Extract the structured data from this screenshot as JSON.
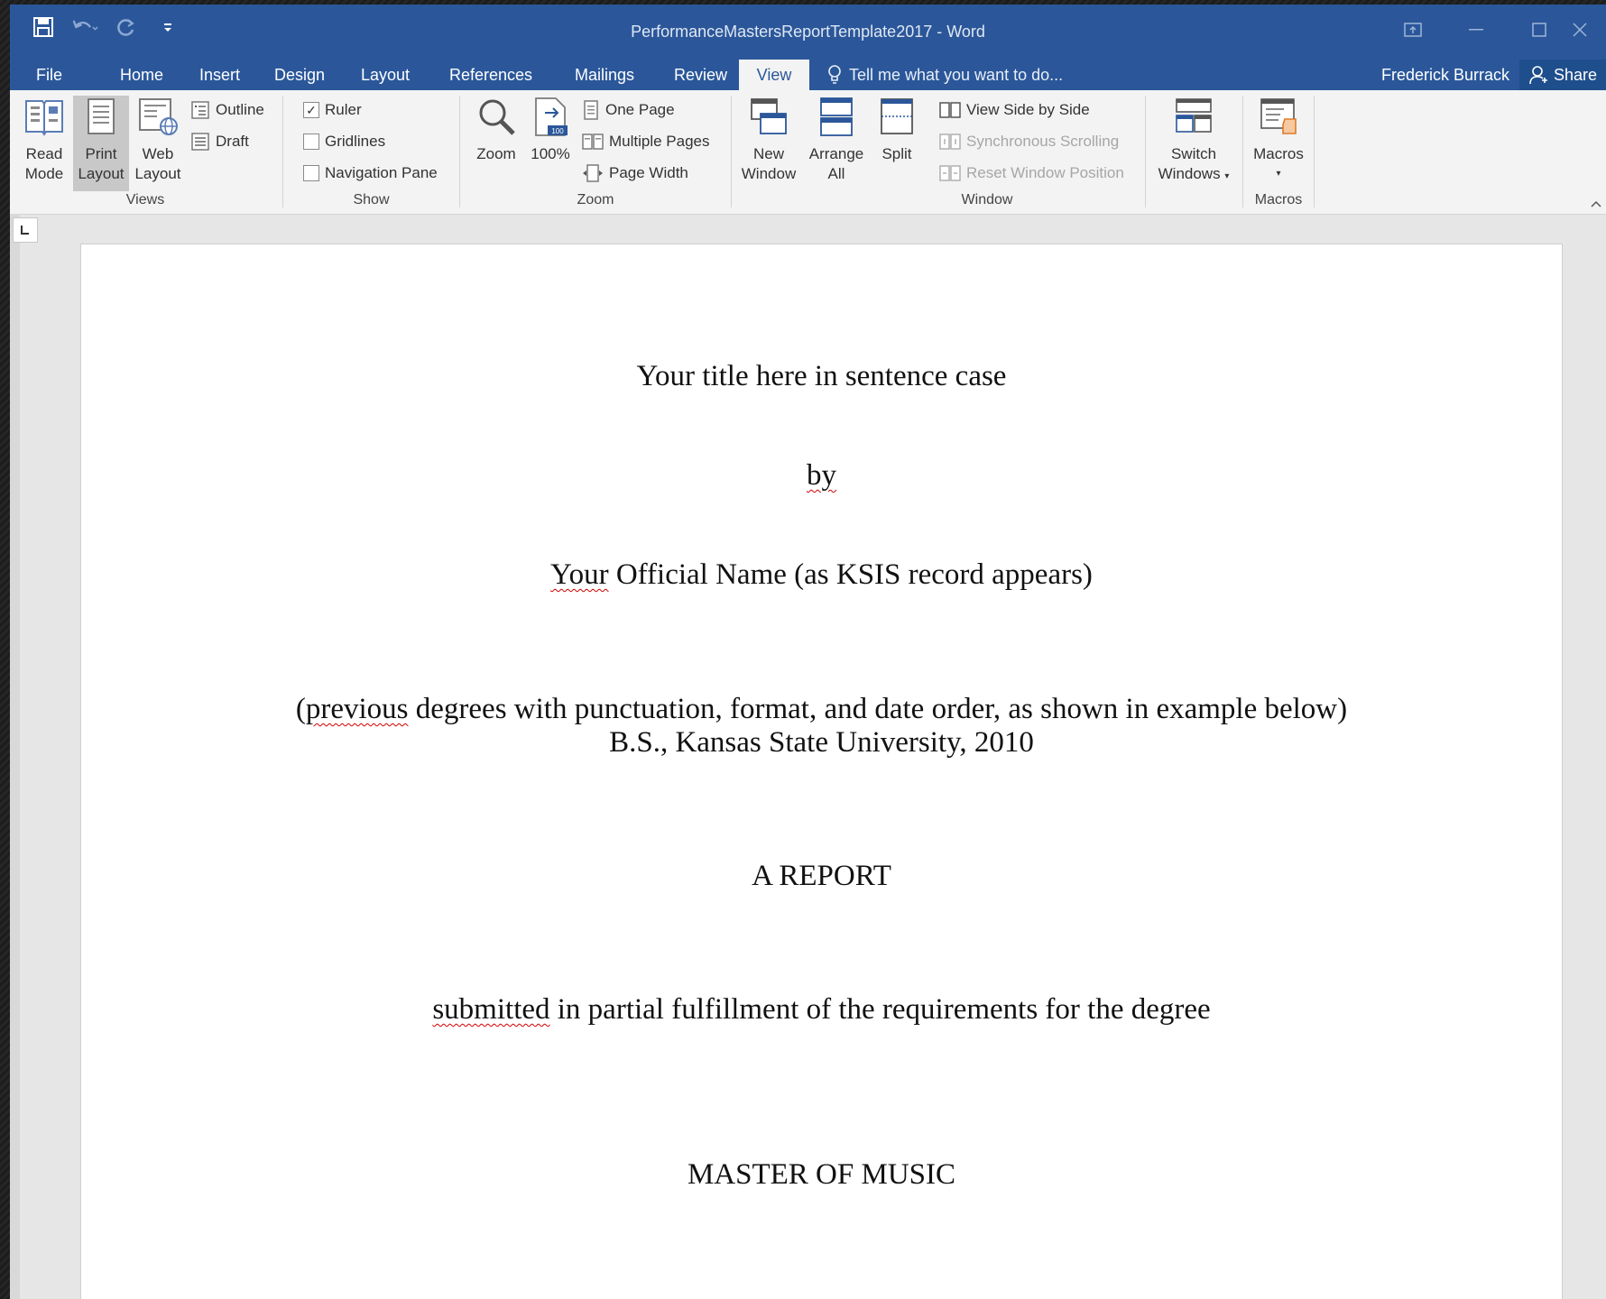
{
  "window": {
    "title": "PerformanceMastersReportTemplate2017 - Word"
  },
  "tabs": [
    "File",
    "Home",
    "Insert",
    "Design",
    "Layout",
    "References",
    "Mailings",
    "Review",
    "View"
  ],
  "active_tab": "View",
  "tell_me": "Tell me what you want to do...",
  "user": "Frederick Burrack",
  "share": "Share",
  "ribbon": {
    "views": {
      "label": "Views",
      "read_mode": [
        "Read",
        "Mode"
      ],
      "print_layout": [
        "Print",
        "Layout"
      ],
      "web_layout": [
        "Web",
        "Layout"
      ],
      "outline": "Outline",
      "draft": "Draft"
    },
    "show": {
      "label": "Show",
      "ruler": "Ruler",
      "ruler_checked": true,
      "gridlines": "Gridlines",
      "navigation_pane": "Navigation Pane"
    },
    "zoom": {
      "label": "Zoom",
      "zoom": "Zoom",
      "hundred": "100%",
      "one_page": "One Page",
      "multiple_pages": "Multiple Pages",
      "page_width": "Page Width"
    },
    "window": {
      "label": "Window",
      "new_window": [
        "New",
        "Window"
      ],
      "arrange_all": [
        "Arrange",
        "All"
      ],
      "split": "Split",
      "side_by_side": "View Side by Side",
      "sync_scrolling": "Synchronous Scrolling",
      "reset_position": "Reset Window Position",
      "switch_windows": [
        "Switch",
        "Windows"
      ]
    },
    "macros": {
      "label": "Macros",
      "macros": "Macros"
    }
  },
  "document": {
    "title_line": "Your title here in sentence case",
    "by": "by",
    "name_first": "Your",
    "name_rest": " Official Name (as KSIS record appears)",
    "previous_open": "(",
    "previous_word": "previous",
    "previous_rest": " degrees with punctuation, format, and date order, as shown in example below)",
    "degree_example": "B.S., Kansas State University, 2010",
    "report": "A REPORT",
    "submitted_word": "submitted",
    "submitted_rest": " in partial fulfillment of the requirements for the degree",
    "degree": "MASTER OF MUSIC"
  },
  "colors": {
    "accent": "#2b579a",
    "ribbon_bg": "#f3f3f3",
    "spell_underline": "#d00000"
  }
}
